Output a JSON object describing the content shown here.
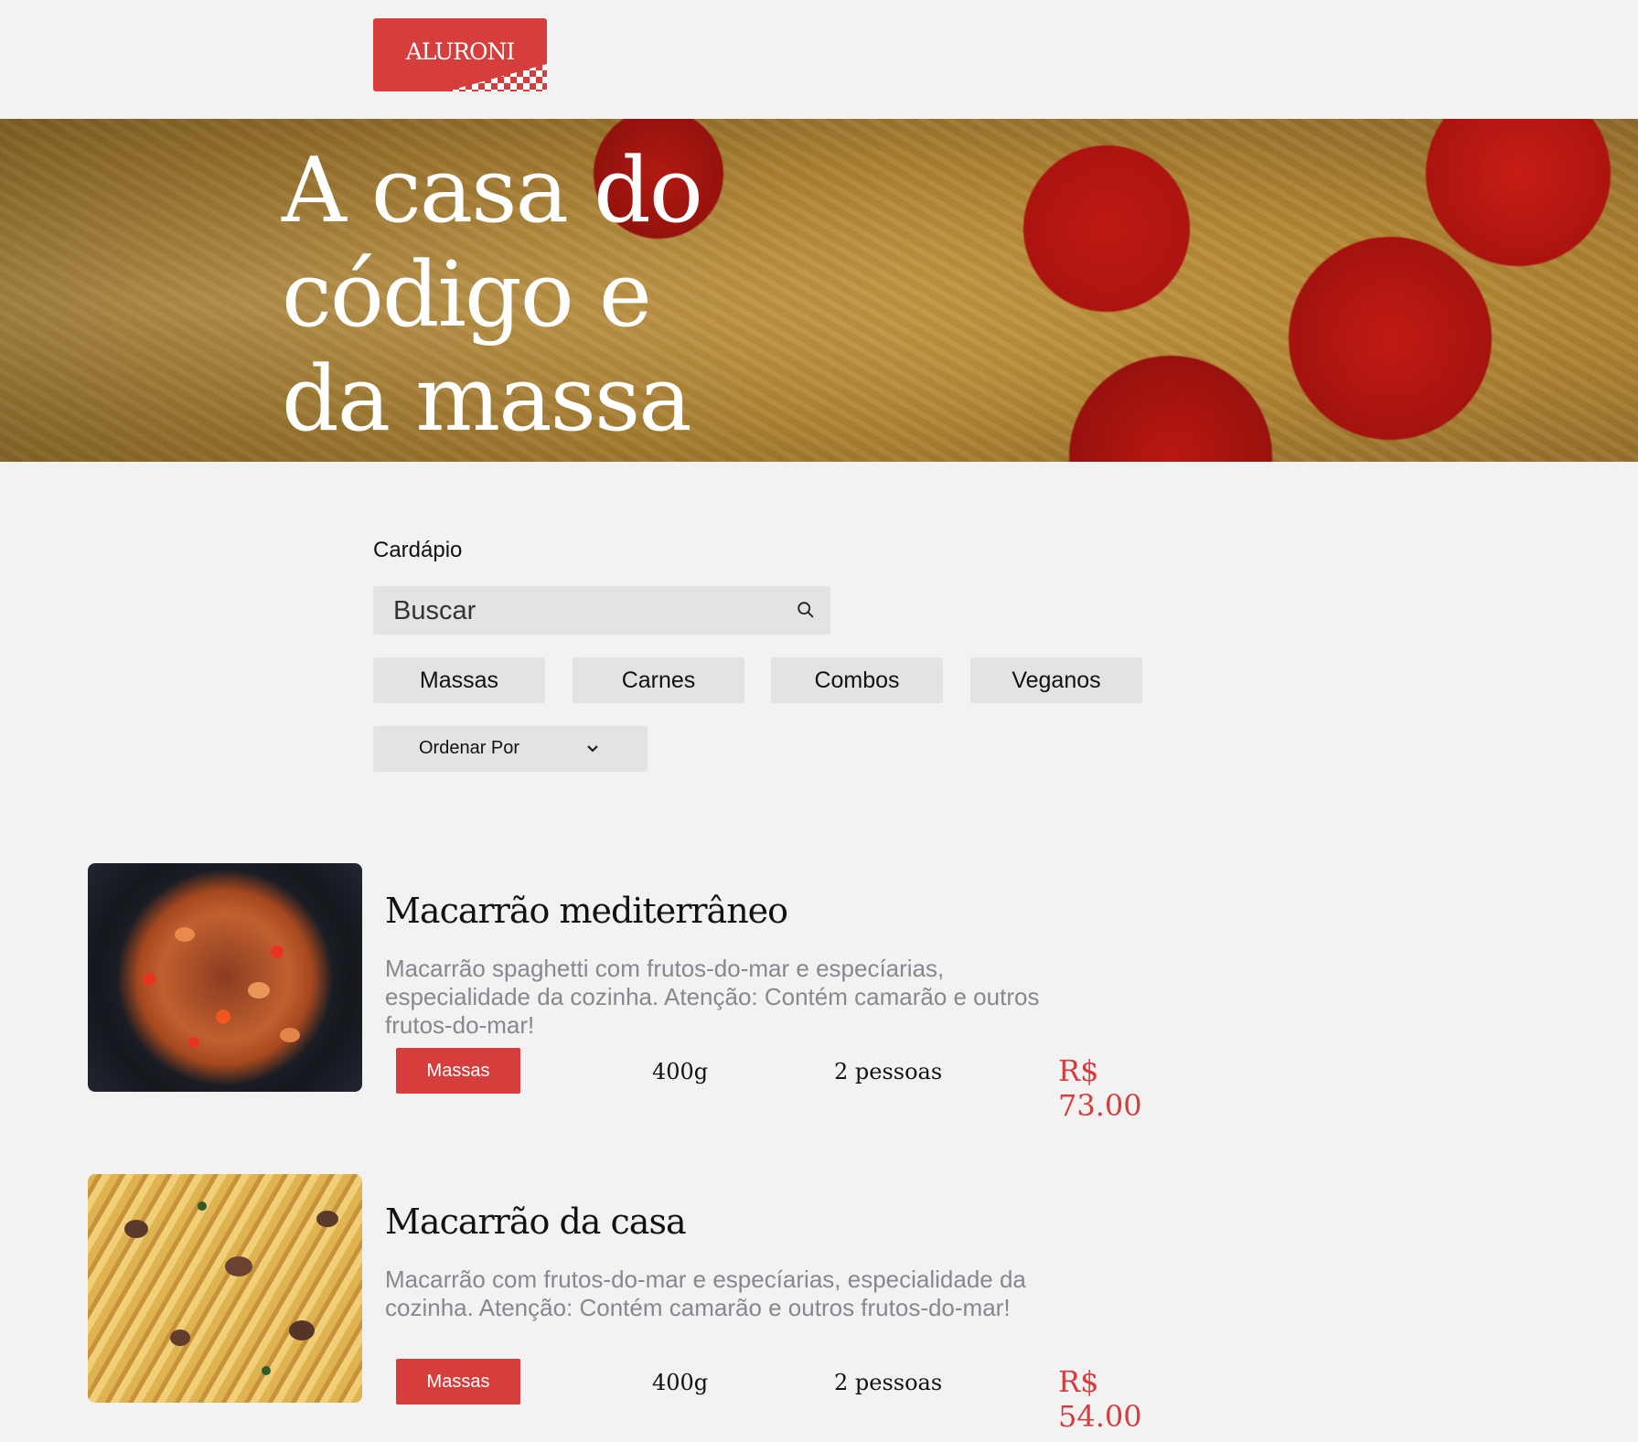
{
  "brand": {
    "logo_text": "ALURONI",
    "accent": "#d63d3d"
  },
  "hero": {
    "title": "A casa do código e da massa"
  },
  "menu": {
    "label": "Cardápio",
    "search": {
      "placeholder": "Buscar",
      "value": ""
    },
    "categories": [
      "Massas",
      "Carnes",
      "Combos",
      "Veganos"
    ],
    "sort": {
      "label": "Ordenar Por"
    }
  },
  "items": [
    {
      "title": "Macarrão mediterrâneo",
      "description": "Macarrão spaghetti com frutos-do-mar e especíarias, especialidade da cozinha. Atenção: Contém camarão e outros frutos-do-mar!",
      "category": "Massas",
      "weight": "400g",
      "serves": "2 pessoas",
      "price": "R$ 73.00"
    },
    {
      "title": "Macarrão da casa",
      "description": "Macarrão com frutos-do-mar e especíarias, especialidade da cozinha. Atenção: Contém camarão e outros frutos-do-mar!",
      "category": "Massas",
      "weight": "400g",
      "serves": "2 pessoas",
      "price": "R$ 54.00"
    }
  ]
}
